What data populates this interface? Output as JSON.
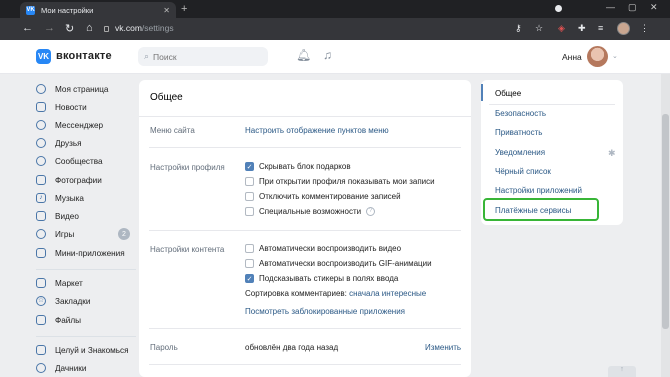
{
  "browser": {
    "tab_title": "Мои настройки",
    "url_host": "vk.com",
    "url_path": "/settings"
  },
  "header": {
    "logo_text": "вконтакте",
    "search_placeholder": "Поиск",
    "user_name": "Анна"
  },
  "sidebar": {
    "items": [
      {
        "label": "Моя страница",
        "icon": "home-icon"
      },
      {
        "label": "Новости",
        "icon": "news-icon"
      },
      {
        "label": "Мессенджер",
        "icon": "messenger-icon"
      },
      {
        "label": "Друзья",
        "icon": "friends-icon"
      },
      {
        "label": "Сообщества",
        "icon": "communities-icon"
      },
      {
        "label": "Фотографии",
        "icon": "photos-icon"
      },
      {
        "label": "Музыка",
        "icon": "music-icon"
      },
      {
        "label": "Видео",
        "icon": "video-icon"
      },
      {
        "label": "Игры",
        "icon": "games-icon",
        "badge": "2"
      },
      {
        "label": "Мини-приложения",
        "icon": "apps-icon"
      },
      {
        "label": "Маркет",
        "icon": "market-icon"
      },
      {
        "label": "Закладки",
        "icon": "bookmarks-icon"
      },
      {
        "label": "Файлы",
        "icon": "files-icon"
      },
      {
        "label": "Целуй и Знакомься",
        "icon": "app-icon"
      },
      {
        "label": "Дачники",
        "icon": "app-icon"
      }
    ]
  },
  "main": {
    "title": "Общее",
    "menu_label": "Меню сайта",
    "menu_link": "Настроить отображение пунктов меню",
    "profile_label": "Настройки профиля",
    "profile_options": [
      {
        "label": "Скрывать блок подарков",
        "checked": true
      },
      {
        "label": "При открытии профиля показывать мои записи",
        "checked": false
      },
      {
        "label": "Отключить комментирование записей",
        "checked": false
      },
      {
        "label": "Специальные возможности",
        "checked": false
      }
    ],
    "content_label": "Настройки контента",
    "content_options": [
      {
        "label": "Автоматически воспроизводить видео",
        "checked": false
      },
      {
        "label": "Автоматически воспроизводить GIF-анимации",
        "checked": false
      },
      {
        "label": "Подсказывать стикеры в полях ввода",
        "checked": true
      }
    ],
    "sort_label": "Сортировка комментариев:",
    "sort_value": "сначала интересные",
    "blocked_apps_link": "Посмотреть заблокированные приложения",
    "password_label": "Пароль",
    "password_value": "обновлён два года назад",
    "password_change": "Изменить"
  },
  "right_menu": {
    "items": [
      "Общее",
      "Безопасность",
      "Приватность",
      "Уведомления",
      "Чёрный список",
      "Настройки приложений",
      "Платёжные сервисы"
    ],
    "active": "Общее"
  },
  "colors": {
    "accent": "#5181b8",
    "link": "#2a5885",
    "highlight": "#38b537"
  }
}
